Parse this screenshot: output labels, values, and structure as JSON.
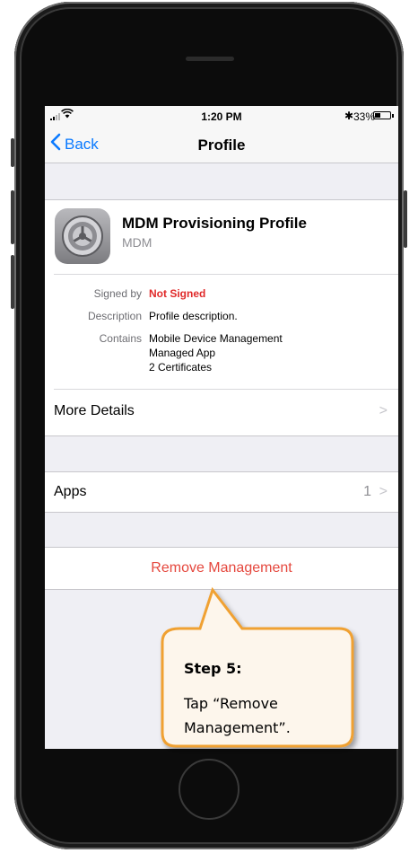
{
  "status_bar": {
    "time": "1:20 PM",
    "battery_percent": "33%",
    "bluetooth_icon": "bluetooth-icon",
    "wifi_icon": "wifi-icon"
  },
  "nav": {
    "back_label": "Back",
    "title": "Profile"
  },
  "profile": {
    "name": "MDM Provisioning Profile",
    "subtitle": "MDM",
    "icon": "settings-gear-icon",
    "details": [
      {
        "label": "Signed by",
        "value": "Not Signed"
      },
      {
        "label": "Description",
        "value": "Profile description."
      },
      {
        "label": "Contains",
        "value": "Mobile Device Management",
        "extra": [
          "Managed App",
          "2 Certificates"
        ]
      }
    ],
    "more_details_label": "More Details"
  },
  "apps": {
    "label": "Apps",
    "count": "1"
  },
  "remove_label": "Remove Management",
  "callout": {
    "title": "Step 5:",
    "line1": "Tap “Remove",
    "line2": "Management”."
  },
  "colors": {
    "accent": "#0a7aff",
    "destructive": "#e5483e",
    "callout_border": "#f0a133",
    "callout_fill": "#fdf6ec"
  }
}
